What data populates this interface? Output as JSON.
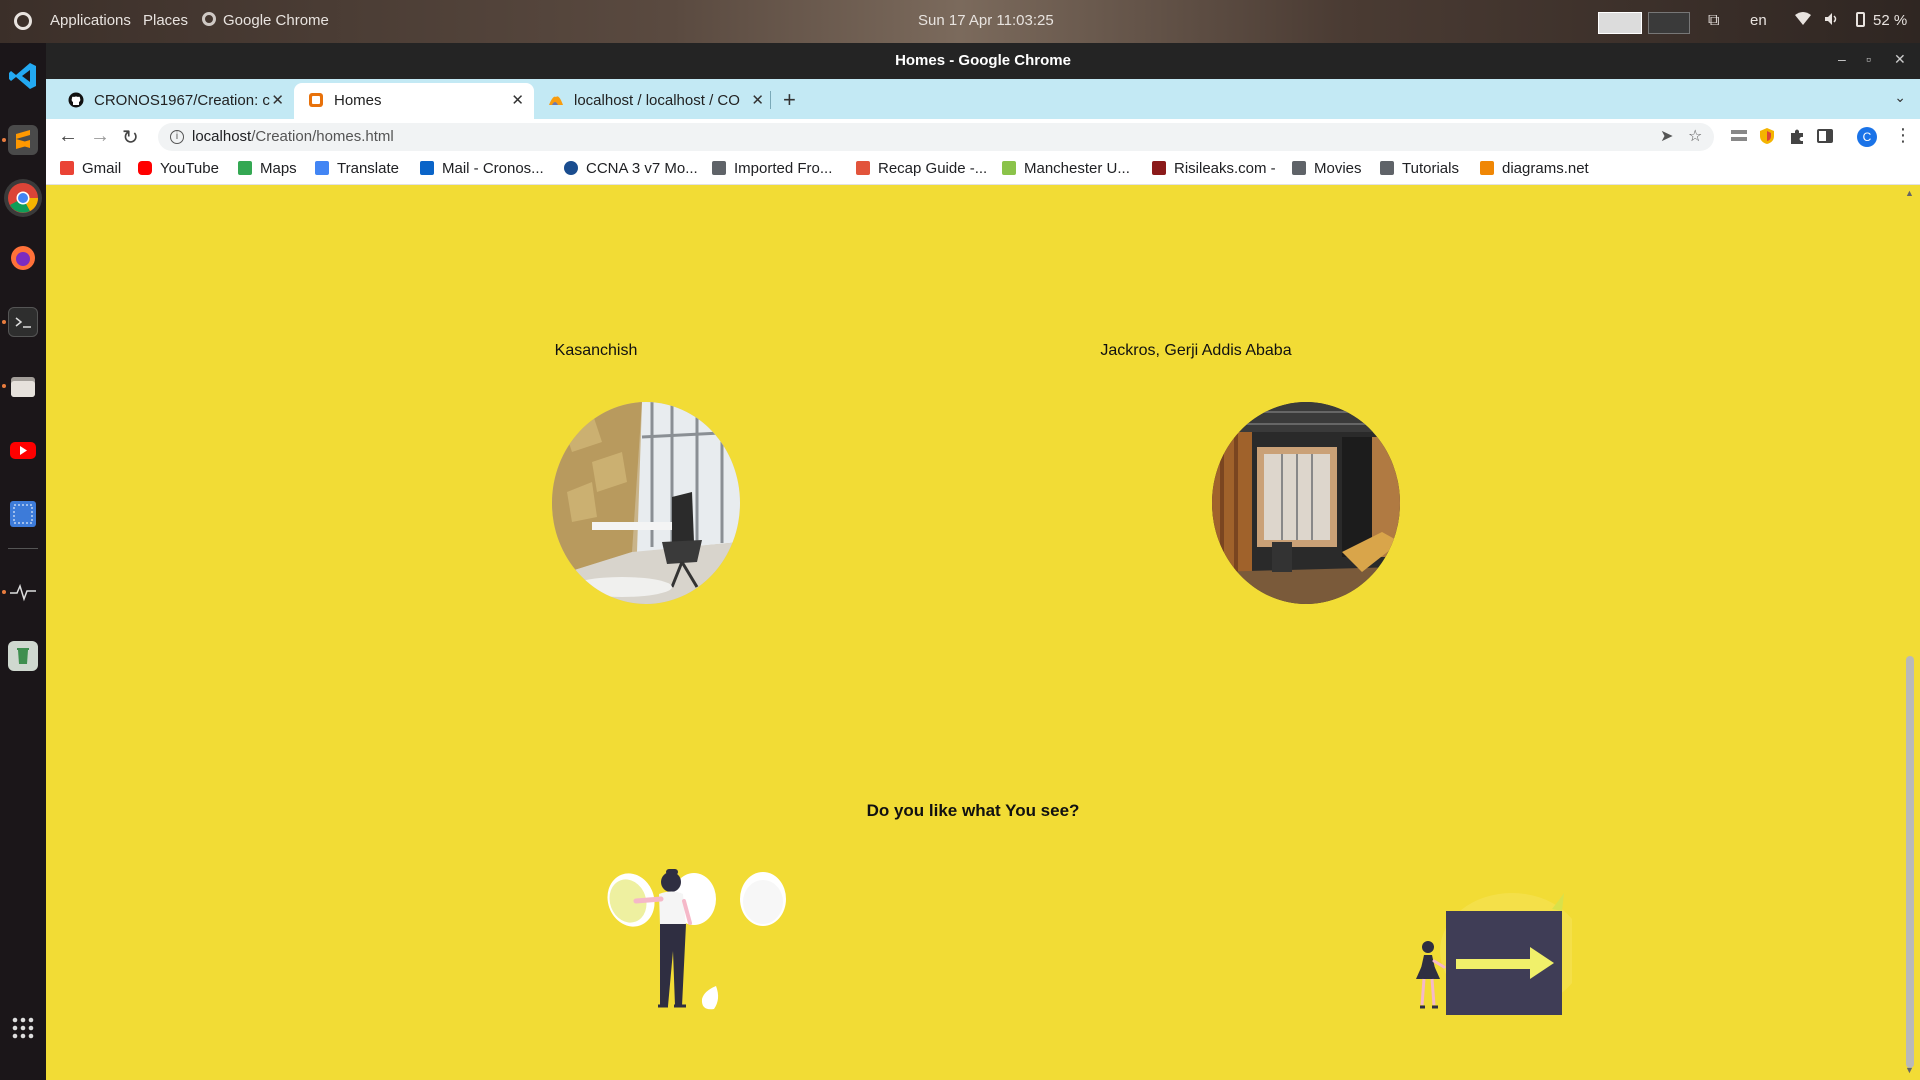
{
  "system": {
    "activities": "",
    "apps_menu": "Applications",
    "places_menu": "Places",
    "active_app": "Google Chrome",
    "clock": "Sun 17 Apr  11:03:25",
    "language": "en",
    "battery": "52 %",
    "icons": [
      "activities-icon",
      "wifi-icon",
      "volume-icon",
      "battery-icon",
      "window-switch-icon"
    ]
  },
  "window": {
    "title": "Homes - Google Chrome",
    "minimize": "–",
    "maximize": "▫",
    "close": "✕"
  },
  "tabs": [
    {
      "label": "CRONOS1967/Creation: c",
      "icon": "github-icon",
      "close": "✕"
    },
    {
      "label": "Homes",
      "icon": "page-icon",
      "close": "✕"
    },
    {
      "label": "localhost / localhost / CO",
      "icon": "phpmyadmin-icon",
      "close": "✕"
    }
  ],
  "new_tab": "+",
  "tab_menu": "⌄",
  "toolbar": {
    "back": "←",
    "forward": "→",
    "reload": "↻",
    "url_host": "localhost",
    "url_path": "/Creation/homes.html",
    "send_icon": "➤",
    "star_icon": "☆",
    "profile_initial": "C",
    "menu": "⋮"
  },
  "bookmarks": [
    {
      "label": "Gmail",
      "icon": "gmail-icon",
      "color": "#ea4335"
    },
    {
      "label": "YouTube",
      "icon": "youtube-icon",
      "color": "#ff0000"
    },
    {
      "label": "Maps",
      "icon": "maps-icon",
      "color": "#34a853"
    },
    {
      "label": "Translate",
      "icon": "translate-icon",
      "color": "#4285f4"
    },
    {
      "label": "Mail - Cronos...",
      "icon": "outlook-icon",
      "color": "#0a64c8"
    },
    {
      "label": "CCNA 3 v7 Mo...",
      "icon": "ccna-icon",
      "color": "#1a4d8f"
    },
    {
      "label": "Imported Fro...",
      "icon": "folder-icon",
      "color": "#5f6368"
    },
    {
      "label": "Recap Guide -...",
      "icon": "recap-icon",
      "color": "#e2543b"
    },
    {
      "label": "Manchester U...",
      "icon": "manchester-icon",
      "color": "#8bc34a"
    },
    {
      "label": "Risileaks.com -",
      "icon": "risileaks-icon",
      "color": "#8b1a1a"
    },
    {
      "label": "Movies",
      "icon": "folder-icon",
      "color": "#5f6368"
    },
    {
      "label": "Tutorials",
      "icon": "folder-icon",
      "color": "#5f6368"
    },
    {
      "label": "diagrams.net",
      "icon": "drawio-icon",
      "color": "#f08705"
    }
  ],
  "page": {
    "locations": [
      {
        "name": "Kasanchish",
        "photo": "office-photo-kasanchish"
      },
      {
        "name": "Jackros, Gerji Addis Ababa",
        "photo": "office-photo-jackros"
      }
    ],
    "question": "Do you like what You see?",
    "background": "#f2dc35"
  }
}
